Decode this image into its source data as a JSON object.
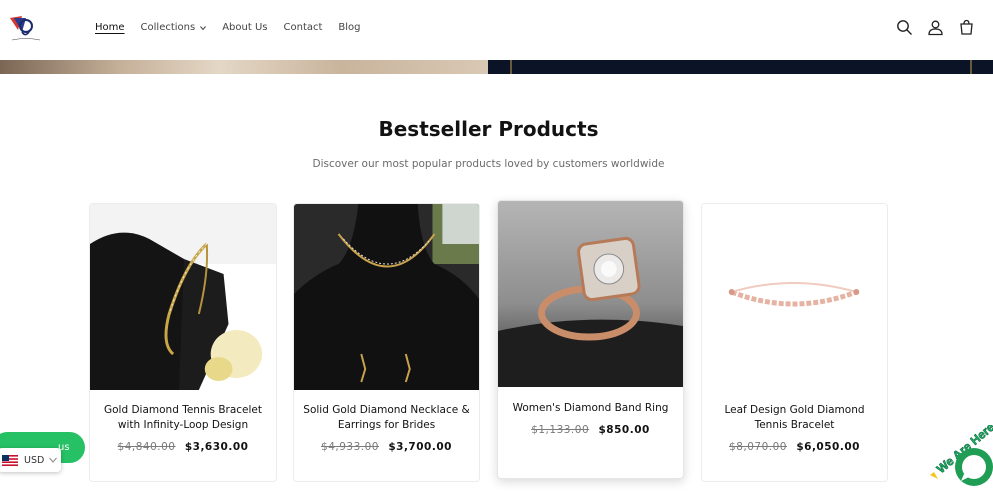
{
  "header": {
    "nav": [
      {
        "label": "Home",
        "active": true,
        "dropdown": false
      },
      {
        "label": "Collections",
        "active": false,
        "dropdown": true
      },
      {
        "label": "About Us",
        "active": false,
        "dropdown": false
      },
      {
        "label": "Contact",
        "active": false,
        "dropdown": false
      },
      {
        "label": "Blog",
        "active": false,
        "dropdown": false
      }
    ],
    "icons": [
      "search-icon",
      "account-icon",
      "cart-icon"
    ]
  },
  "section": {
    "title": "Bestseller Products",
    "subtitle": "Discover our most popular products loved by customers worldwide"
  },
  "products": [
    {
      "title": "Gold Diamond Tennis Bracelet with Infinity-Loop Design",
      "old_price": "$4,840.00",
      "price": "$3,630.00"
    },
    {
      "title": "Solid Gold Diamond Necklace & Earrings for Brides",
      "old_price": "$4,933.00",
      "price": "$3,700.00"
    },
    {
      "title": "Women's Diamond Band Ring",
      "old_price": "$1,133.00",
      "price": "$850.00"
    },
    {
      "title": "Leaf Design Gold Diamond Tennis Bracelet",
      "old_price": "$8,070.00",
      "price": "$6,050.00"
    }
  ],
  "widgets": {
    "chat_pill_text": "us",
    "currency": "USD",
    "chat_badge_text": "We Are Here"
  },
  "colors": {
    "accent_green": "#26c165",
    "banner_dark": "#0b1426"
  }
}
